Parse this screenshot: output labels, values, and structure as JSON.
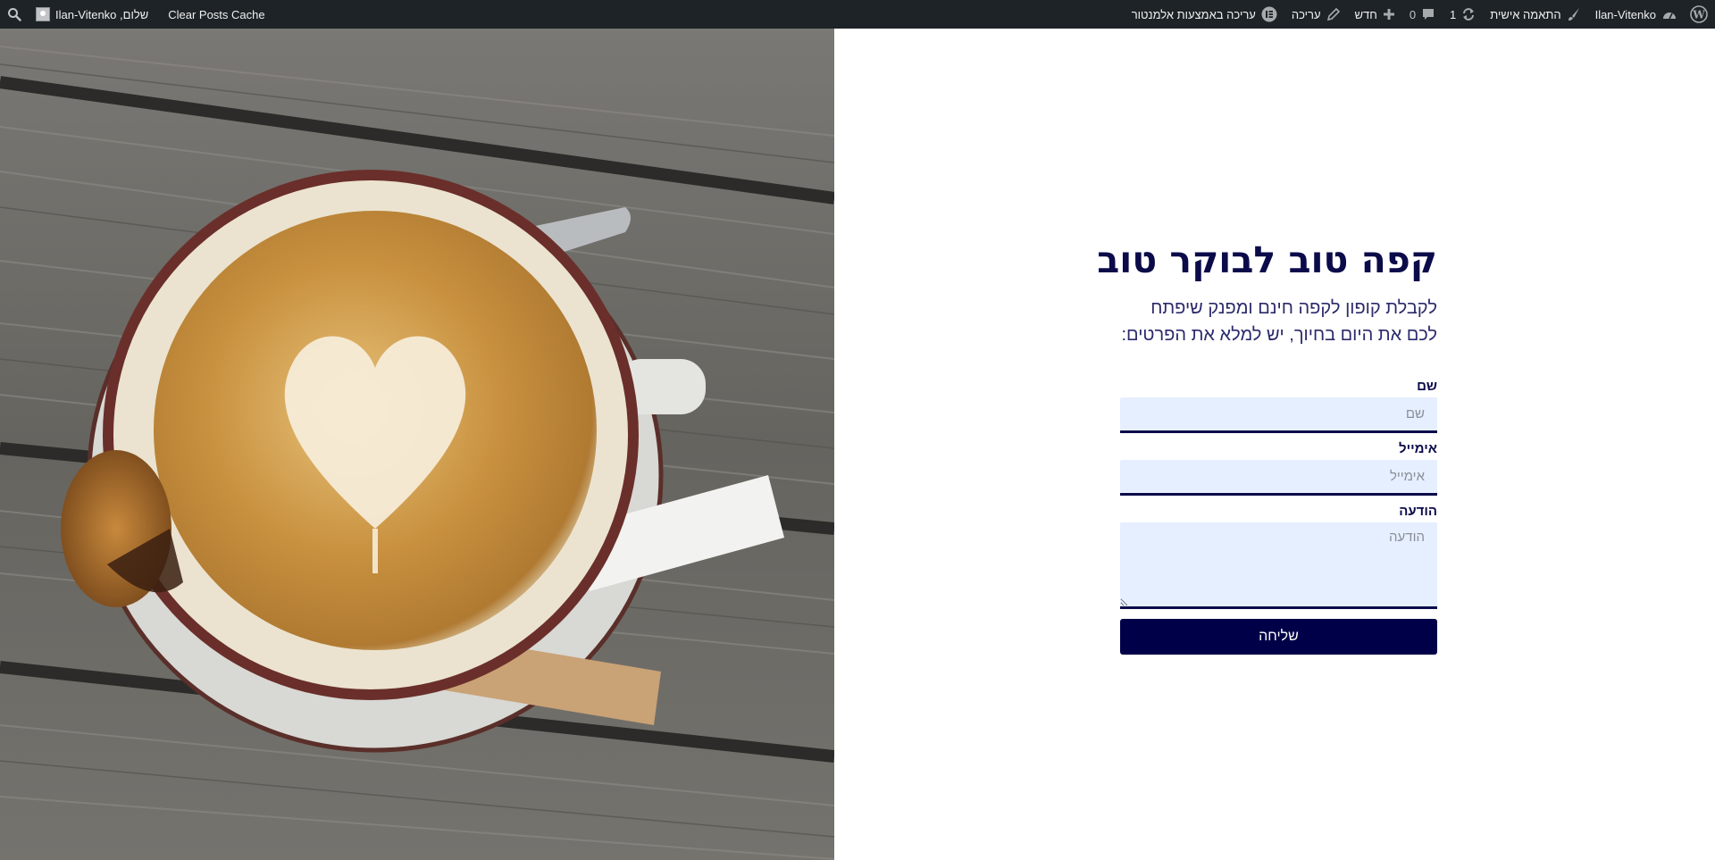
{
  "adminbar": {
    "site_name": "Ilan-Vitenko",
    "customize": "התאמה אישית",
    "updates_count": "1",
    "comments_count": "0",
    "new_label": "חדש",
    "edit_label": "עריכה",
    "elementor_label": "עריכה באמצעות אלמנטור",
    "elementor_badge": "E",
    "clear_cache": "Clear Posts Cache",
    "greeting": "שלום, Ilan-Vitenko",
    "background_color": "#1d2327"
  },
  "hero_image": {
    "description_icon": "coffee-latte-photo"
  },
  "form": {
    "title": "קפה טוב לבוקר טוב",
    "subtitle": "לקבלת קופון לקפה חינם ומפנק שיפתח לכם את היום בחיוך, יש למלא את הפרטים:",
    "fields": {
      "name": {
        "label": "שם",
        "placeholder": "שם"
      },
      "email": {
        "label": "אימייל",
        "placeholder": "אימייל"
      },
      "message": {
        "label": "הודעה",
        "placeholder": "הודעה"
      }
    },
    "submit_label": "שליחה",
    "colors": {
      "primary": "#000048",
      "field_bg": "#e6efff"
    }
  }
}
